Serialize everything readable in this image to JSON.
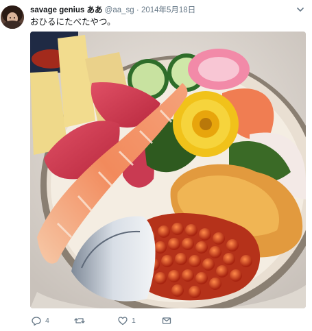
{
  "tweet": {
    "display_name": "savage genius ああ",
    "handle": "@aa_sg",
    "separator": "·",
    "timestamp": "2014年5月18日",
    "text": "おひるにたべたやつ。"
  },
  "actions": {
    "reply_count": "4",
    "retweet_count": "",
    "like_count": "1"
  },
  "icons": {
    "reply": "reply-icon",
    "retweet": "retweet-icon",
    "like": "heart-icon",
    "message": "envelope-icon",
    "menu": "chevron-down-icon"
  },
  "colors": {
    "secondary_text": "#657786",
    "primary_text": "#14171a"
  }
}
